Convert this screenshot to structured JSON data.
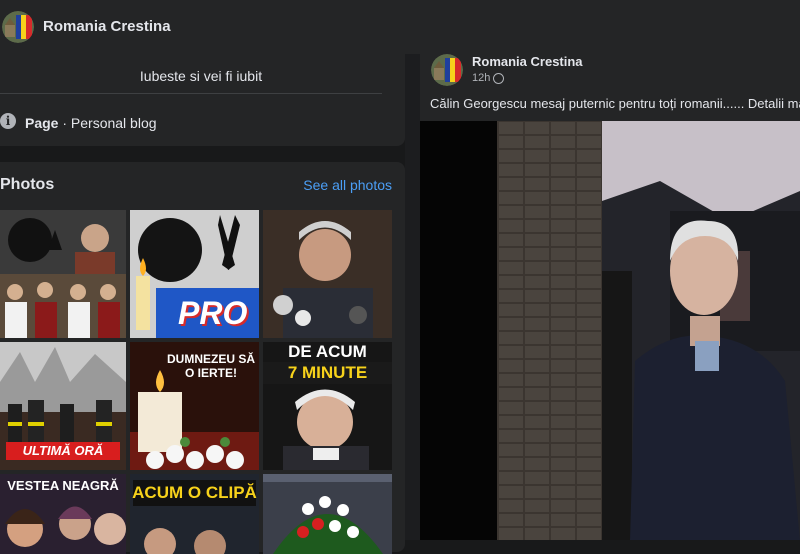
{
  "header": {
    "page_name": "Romania Crestina",
    "avatar_icon": "romania-flag-avatar-icon"
  },
  "intro": {
    "bio": "Iubeste si vei fi iubit",
    "category_label": "Page",
    "category_value": " · Personal blog"
  },
  "photos": {
    "title": "Photos",
    "see_all": "See all photos",
    "captions": {
      "pro": "PRO",
      "dumnezeu": "DUMNEZEU SĂ O IERTE!",
      "de_acum": "DE ACUM",
      "minute": "7 MINUTE",
      "ultima_ora": "ULTIMĂ ORĂ",
      "vestea": "VESTEA NEAGRĂ",
      "acum_o_clipa": "ACUM O CLIPĂ"
    }
  },
  "post": {
    "author": "Romania Crestina",
    "time": "12h",
    "privacy_icon": "globe-icon",
    "text": "Călin Georgescu mesaj puternic pentru toți romanii...... Detalii mai jos"
  },
  "colors": {
    "background": "#18191a",
    "card": "#242526",
    "link": "#4b9ef5",
    "secondary_text": "#b0b3b8"
  }
}
